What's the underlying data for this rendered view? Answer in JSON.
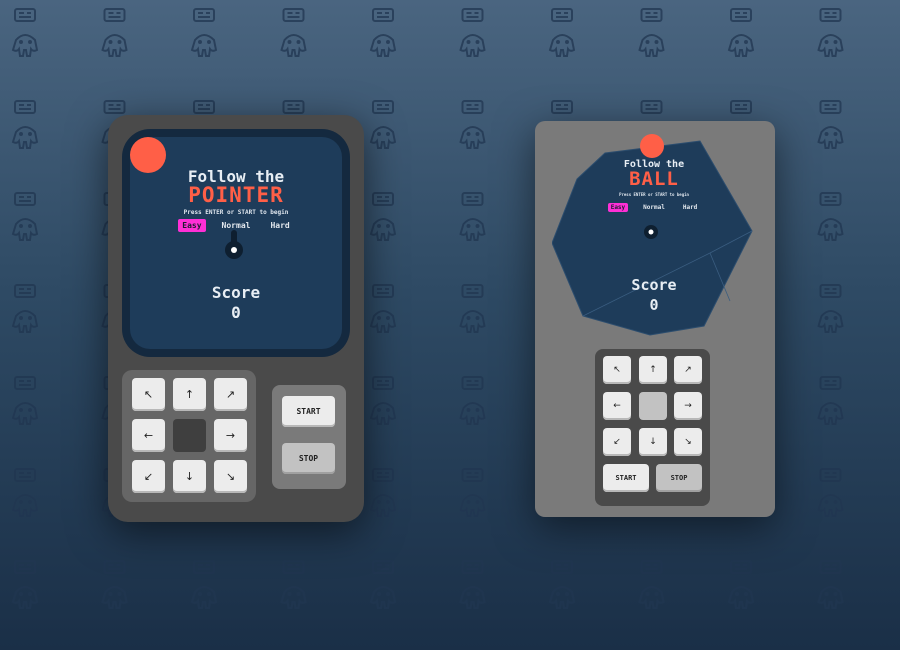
{
  "colors": {
    "accent": "#ff5f47",
    "easy_highlight": "#ff2fd6",
    "screen": "#1e3c5a",
    "background_top": "#4a6580",
    "background_bottom": "#1a2f47"
  },
  "background_icons": [
    "gamepad-icon",
    "elephant-icon"
  ],
  "device1": {
    "title_small": "Follow the",
    "title_big": "POINTER",
    "subtitle": "Press ENTER or START to begin",
    "difficulties": [
      "Easy",
      "Normal",
      "Hard"
    ],
    "selected_difficulty": "Easy",
    "score_label": "Score",
    "score_value": "0",
    "dpad": {
      "up_left": "↖",
      "up": "↑",
      "up_right": "↗",
      "left": "←",
      "right": "→",
      "down_left": "↙",
      "down": "↓",
      "down_right": "↘"
    },
    "start_label": "START",
    "stop_label": "STOP"
  },
  "device2": {
    "title_small": "Follow the",
    "title_big": "BALL",
    "subtitle": "Press ENTER or START to begin",
    "difficulties": [
      "Easy",
      "Normal",
      "Hard"
    ],
    "selected_difficulty": "Easy",
    "score_label": "Score",
    "score_value": "0",
    "dpad": {
      "up_left": "↖",
      "up": "↑",
      "up_right": "↗",
      "left": "←",
      "right": "→",
      "down_left": "↙",
      "down": "↓",
      "down_right": "↘"
    },
    "start_label": "START",
    "stop_label": "STOP"
  }
}
